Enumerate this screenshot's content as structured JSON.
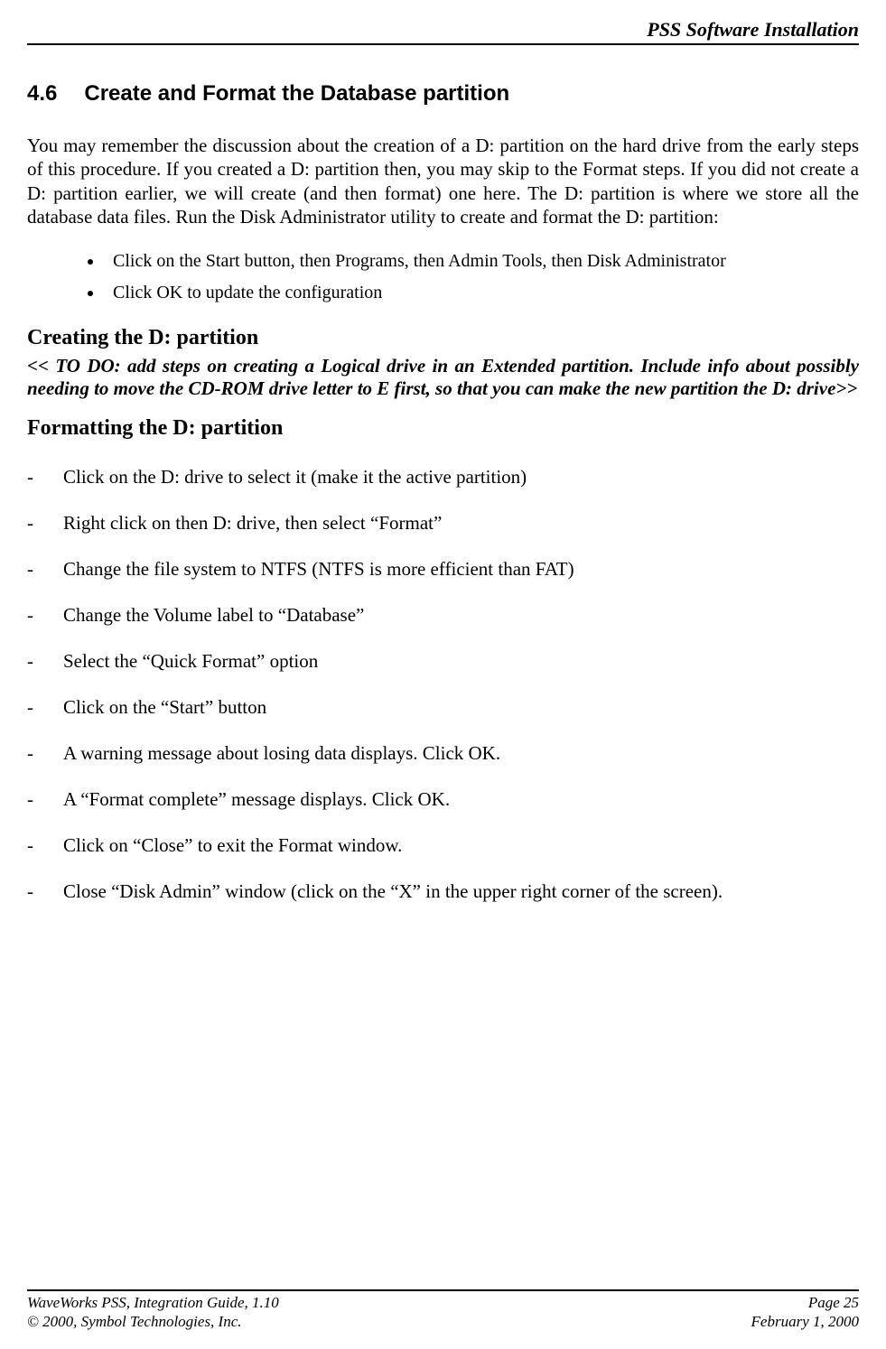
{
  "header": {
    "title": "PSS Software Installation"
  },
  "section": {
    "number": "4.6",
    "title": "Create and Format the Database partition",
    "intro": "You may remember the discussion about the creation of a D: partition on the hard drive from the early steps of this procedure.  If you created a D: partition then, you may skip to the Format steps.  If you did not create a D: partition earlier, we will create (and then format) one here.  The D: partition is where we store all the database data files.  Run the Disk Administrator utility to create and format the D: partition:",
    "bullets": [
      "Click on the Start button, then Programs, then Admin Tools, then Disk Administrator",
      "Click OK to update the configuration"
    ]
  },
  "creating": {
    "heading": "Creating the D: partition",
    "todo": "<< TO DO: add steps on creating a Logical drive in an Extended partition.  Include info about possibly needing to move the CD-ROM drive letter to E first, so that you can make the new partition the D: drive>>"
  },
  "formatting": {
    "heading": "Formatting the D: partition",
    "steps": [
      "Click on the D: drive to select it (make it the active partition)",
      "Right click on then D: drive, then select “Format”",
      "Change the file system to NTFS (NTFS is more efficient than FAT)",
      "Change the Volume label to “Database”",
      "Select the “Quick Format” option",
      "Click on the “Start” button",
      "A warning message about losing data displays.  Click OK.",
      "A “Format complete” message displays.  Click OK.",
      "Click on “Close” to exit the Format window.",
      "Close “Disk Admin” window (click on the “X” in the upper right corner of the screen)."
    ]
  },
  "footer": {
    "left1": "WaveWorks PSS, Integration Guide, 1.10",
    "right1": "Page 25",
    "left2": "© 2000, Symbol Technologies, Inc.",
    "right2": "February 1, 2000"
  }
}
